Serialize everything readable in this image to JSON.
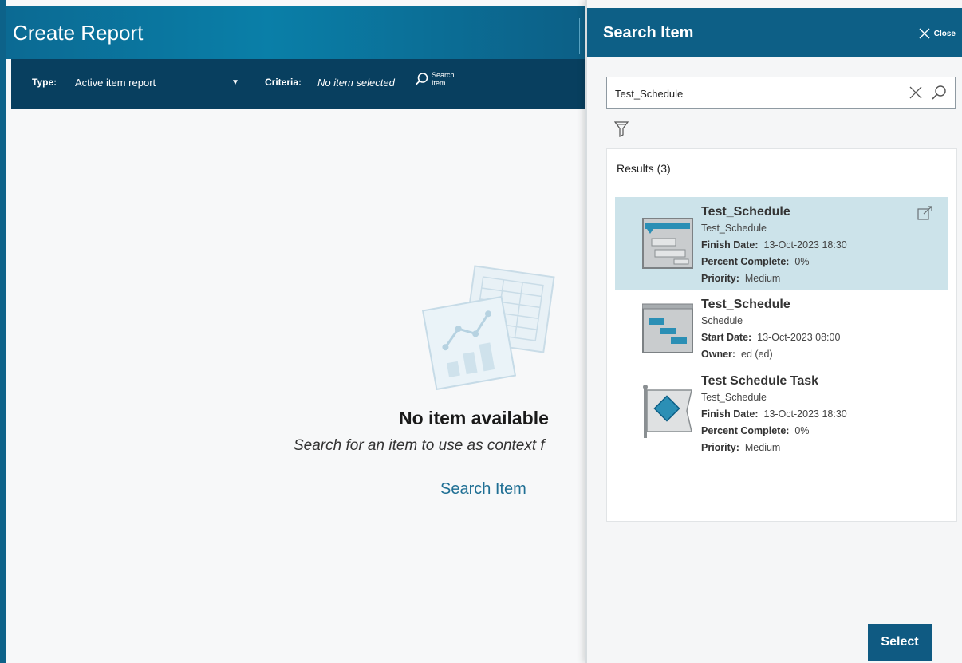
{
  "report": {
    "title": "Create Report",
    "toolbar": {
      "type_label": "Type:",
      "type_value": "Active item report",
      "criteria_label": "Criteria:",
      "criteria_value": "No item selected",
      "search_label_line1": "Search",
      "search_label_line2": "Item"
    },
    "empty_state": {
      "title": "No item available",
      "subtitle": "Search for an item to use as context f",
      "link": "Search Item"
    }
  },
  "panel": {
    "title": "Search Item",
    "close_label": "Close",
    "search_value": "Test_Schedule",
    "results_header": "Results (3)",
    "results": [
      {
        "name": "Test_Schedule",
        "subtitle": "Test_Schedule",
        "fields": [
          {
            "label": "Finish Date:",
            "value": "13-Oct-2023 18:30"
          },
          {
            "label": "Percent Complete:",
            "value": "0%"
          },
          {
            "label": "Priority:",
            "value": "Medium"
          }
        ],
        "icon": "schedule-gantt-icon",
        "selected": true
      },
      {
        "name": "Test_Schedule",
        "subtitle": "Schedule",
        "fields": [
          {
            "label": "Start Date:",
            "value": "13-Oct-2023 08:00"
          },
          {
            "label": "Owner:",
            "value": "ed (ed)"
          }
        ],
        "icon": "schedule-board-icon",
        "selected": false
      },
      {
        "name": "Test Schedule Task",
        "subtitle": "Test_Schedule",
        "fields": [
          {
            "label": "Finish Date:",
            "value": "13-Oct-2023 18:30"
          },
          {
            "label": "Percent Complete:",
            "value": "0%"
          },
          {
            "label": "Priority:",
            "value": "Medium"
          }
        ],
        "icon": "milestone-flag-icon",
        "selected": false
      }
    ],
    "select_label": "Select"
  },
  "colors": {
    "header_blue": "#0d5f86",
    "toolbar_navy": "#083f5f",
    "selected_row": "#cce3ea",
    "link_blue": "#1f6f94"
  }
}
